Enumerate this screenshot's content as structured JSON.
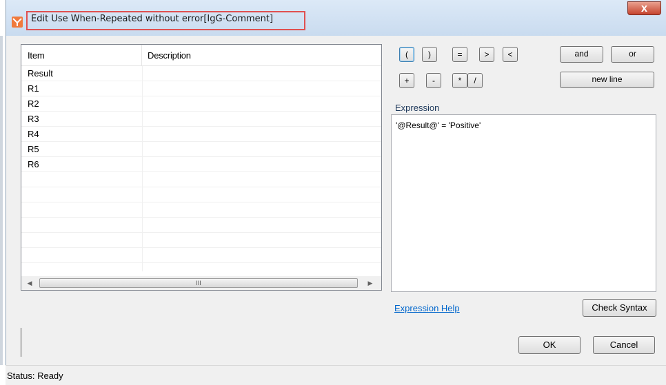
{
  "window": {
    "title": "Edit Use When-Repeated without error[IgG-Comment]",
    "close_label": "X"
  },
  "grid": {
    "columns": [
      "Item",
      "Description"
    ],
    "rows": [
      {
        "item": "Result",
        "description": ""
      },
      {
        "item": "R1",
        "description": ""
      },
      {
        "item": "R2",
        "description": ""
      },
      {
        "item": "R3",
        "description": ""
      },
      {
        "item": "R4",
        "description": ""
      },
      {
        "item": "R5",
        "description": ""
      },
      {
        "item": "R6",
        "description": ""
      }
    ],
    "scroll_thumb_label": "III"
  },
  "operators": {
    "open_paren": "(",
    "close_paren": ")",
    "equals": "=",
    "greater": ">",
    "less": "<",
    "plus": "+",
    "minus": "-",
    "multiply": "*",
    "divide": "/",
    "and": "and",
    "or": "or",
    "new_line": "new line"
  },
  "expression": {
    "label": "Expression",
    "value": "'@Result@' = 'Positive'"
  },
  "links": {
    "expression_help": "Expression Help"
  },
  "buttons": {
    "check_syntax": "Check Syntax",
    "ok": "OK",
    "cancel": "Cancel"
  },
  "status": {
    "text": "Status: Ready"
  },
  "colors": {
    "title_highlight": "#e05050",
    "close_button": "#c6442f",
    "link": "#0066cc",
    "label": "#1e395b"
  }
}
